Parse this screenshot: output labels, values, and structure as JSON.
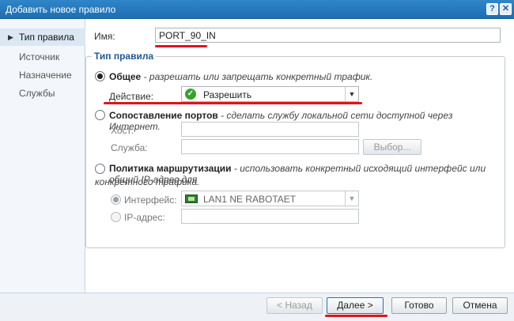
{
  "window": {
    "title": "Добавить новое правило"
  },
  "sidebar": {
    "items": [
      {
        "label": "Тип правила",
        "active": true
      },
      {
        "label": "Источник"
      },
      {
        "label": "Назначение"
      },
      {
        "label": "Службы"
      }
    ]
  },
  "name_field": {
    "label": "Имя:",
    "value": "PORT_90_IN"
  },
  "rule_type": {
    "legend": "Тип правила",
    "general": {
      "title": "Общее",
      "description": "- разрешать или запрещать конкретный трафик.",
      "selected": true,
      "action_label": "Действие:",
      "action_value": "Разрешить"
    },
    "port_mapping": {
      "title": "Сопоставление портов",
      "description": "- сделать службу локальной сети доступной через Интернет.",
      "host_label": "Хост:",
      "service_label": "Служба:",
      "browse_label": "Выбор..."
    },
    "routing": {
      "title": "Политика маршрутизации",
      "description_line1": "- использовать конкретный исходящий интерфейс или общий IP-адрес для",
      "description_line2": "конкретного трафика.",
      "interface_label": "Интерфейс:",
      "interface_value": "LAN1 NE RABOTAET",
      "ip_label": "IP-адрес:"
    }
  },
  "footer": {
    "back_label": "< Назад",
    "next_label": "Далее >",
    "finish_label": "Готово",
    "cancel_label": "Отмена"
  },
  "colors": {
    "title_bar": "#1d6fb2",
    "annotation": "#e0141c",
    "legend": "#1d5a9c"
  }
}
